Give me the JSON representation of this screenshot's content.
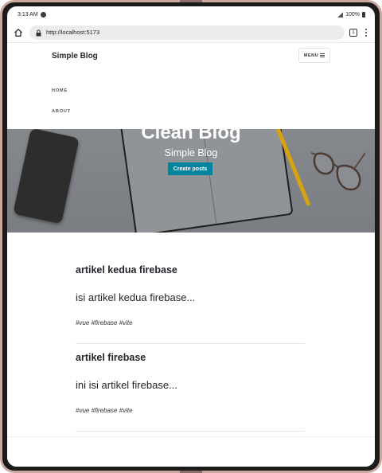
{
  "status_bar": {
    "time": "3:13 AM",
    "battery": "100%"
  },
  "browser": {
    "url": "http://localhost:5173",
    "tab_count": "1"
  },
  "site": {
    "brand": "Simple Blog",
    "menu_label": "MENU",
    "nav_items": [
      "HOME",
      "ABOUT"
    ]
  },
  "hero": {
    "title": "Clean Blog",
    "subtitle": "Simple Blog",
    "button_label": "Create posts",
    "button_color": "#0085a1"
  },
  "posts": [
    {
      "title": "artikel kedua firebase",
      "excerpt": "isi artikel kedua firebase...",
      "tags": "#vue #firebase #vite"
    },
    {
      "title": "artikel firebase",
      "excerpt": "ini isi artikel firebase...",
      "tags": "#vue #firebase #vite"
    }
  ]
}
